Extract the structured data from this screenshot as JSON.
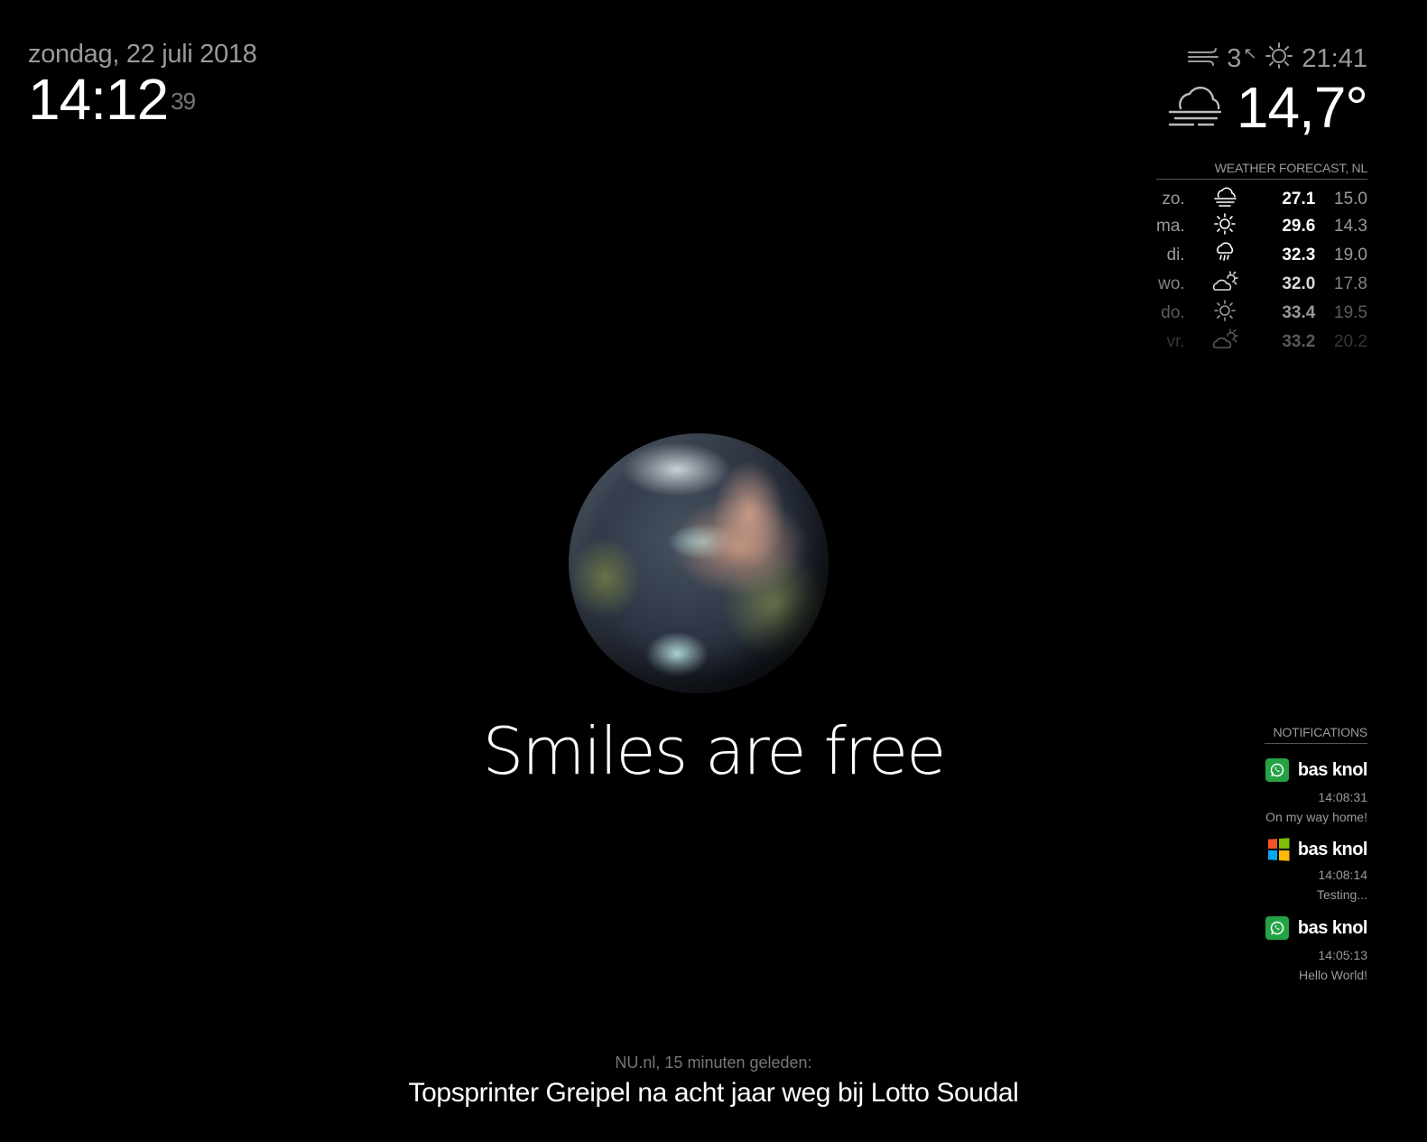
{
  "clock": {
    "date": "zondag, 22 juli 2018",
    "time": "14:12",
    "seconds": "39"
  },
  "current_weather": {
    "wind_speed": "3",
    "wind_direction_symbol": "↖",
    "sunset_time": "21:41",
    "temperature": "14,7°",
    "icons": {
      "wind": "wind-icon",
      "sunset": "sun-icon",
      "condition": "fog-cloud-icon"
    }
  },
  "forecast": {
    "header": "WEATHER FORECAST, NL",
    "days": [
      {
        "day": "zo.",
        "icon": "fog-cloud-icon",
        "max": "27.1",
        "min": "15.0",
        "opacity": 1.0
      },
      {
        "day": "ma.",
        "icon": "sun-icon",
        "max": "29.6",
        "min": "14.3",
        "opacity": 1.0
      },
      {
        "day": "di.",
        "icon": "rain-cloud-icon",
        "max": "32.3",
        "min": "19.0",
        "opacity": 1.0
      },
      {
        "day": "wo.",
        "icon": "partly-cloudy-icon",
        "max": "32.0",
        "min": "17.8",
        "opacity": 0.85
      },
      {
        "day": "do.",
        "icon": "sun-icon",
        "max": "33.4",
        "min": "19.5",
        "opacity": 0.6
      },
      {
        "day": "vr.",
        "icon": "partly-cloudy-icon",
        "max": "33.2",
        "min": "20.2",
        "opacity": 0.35
      }
    ]
  },
  "compliment": "Smiles are free",
  "notifications": {
    "header": "NOTIFICATIONS",
    "items": [
      {
        "app_icon": "whatsapp-icon",
        "sender": "bas knol",
        "time": "14:08:31",
        "message": "On my way home!"
      },
      {
        "app_icon": "windows-icon",
        "sender": "bas knol",
        "time": "14:08:14",
        "message": "Testing..."
      },
      {
        "app_icon": "whatsapp-icon",
        "sender": "bas knol",
        "time": "14:05:13",
        "message": "Hello World!"
      }
    ]
  },
  "news": {
    "source": "NU.nl, 15 minuten geleden:",
    "headline": "Topsprinter Greipel na acht jaar weg bij Lotto Soudal"
  },
  "colors": {
    "background": "#000000",
    "primary_text": "#ffffff",
    "dim_text": "#9a9a9a",
    "whatsapp_green": "#25a244",
    "windows_red": "#f35325",
    "windows_green": "#81bc06",
    "windows_blue": "#05a6f0",
    "windows_yellow": "#ffba08"
  }
}
